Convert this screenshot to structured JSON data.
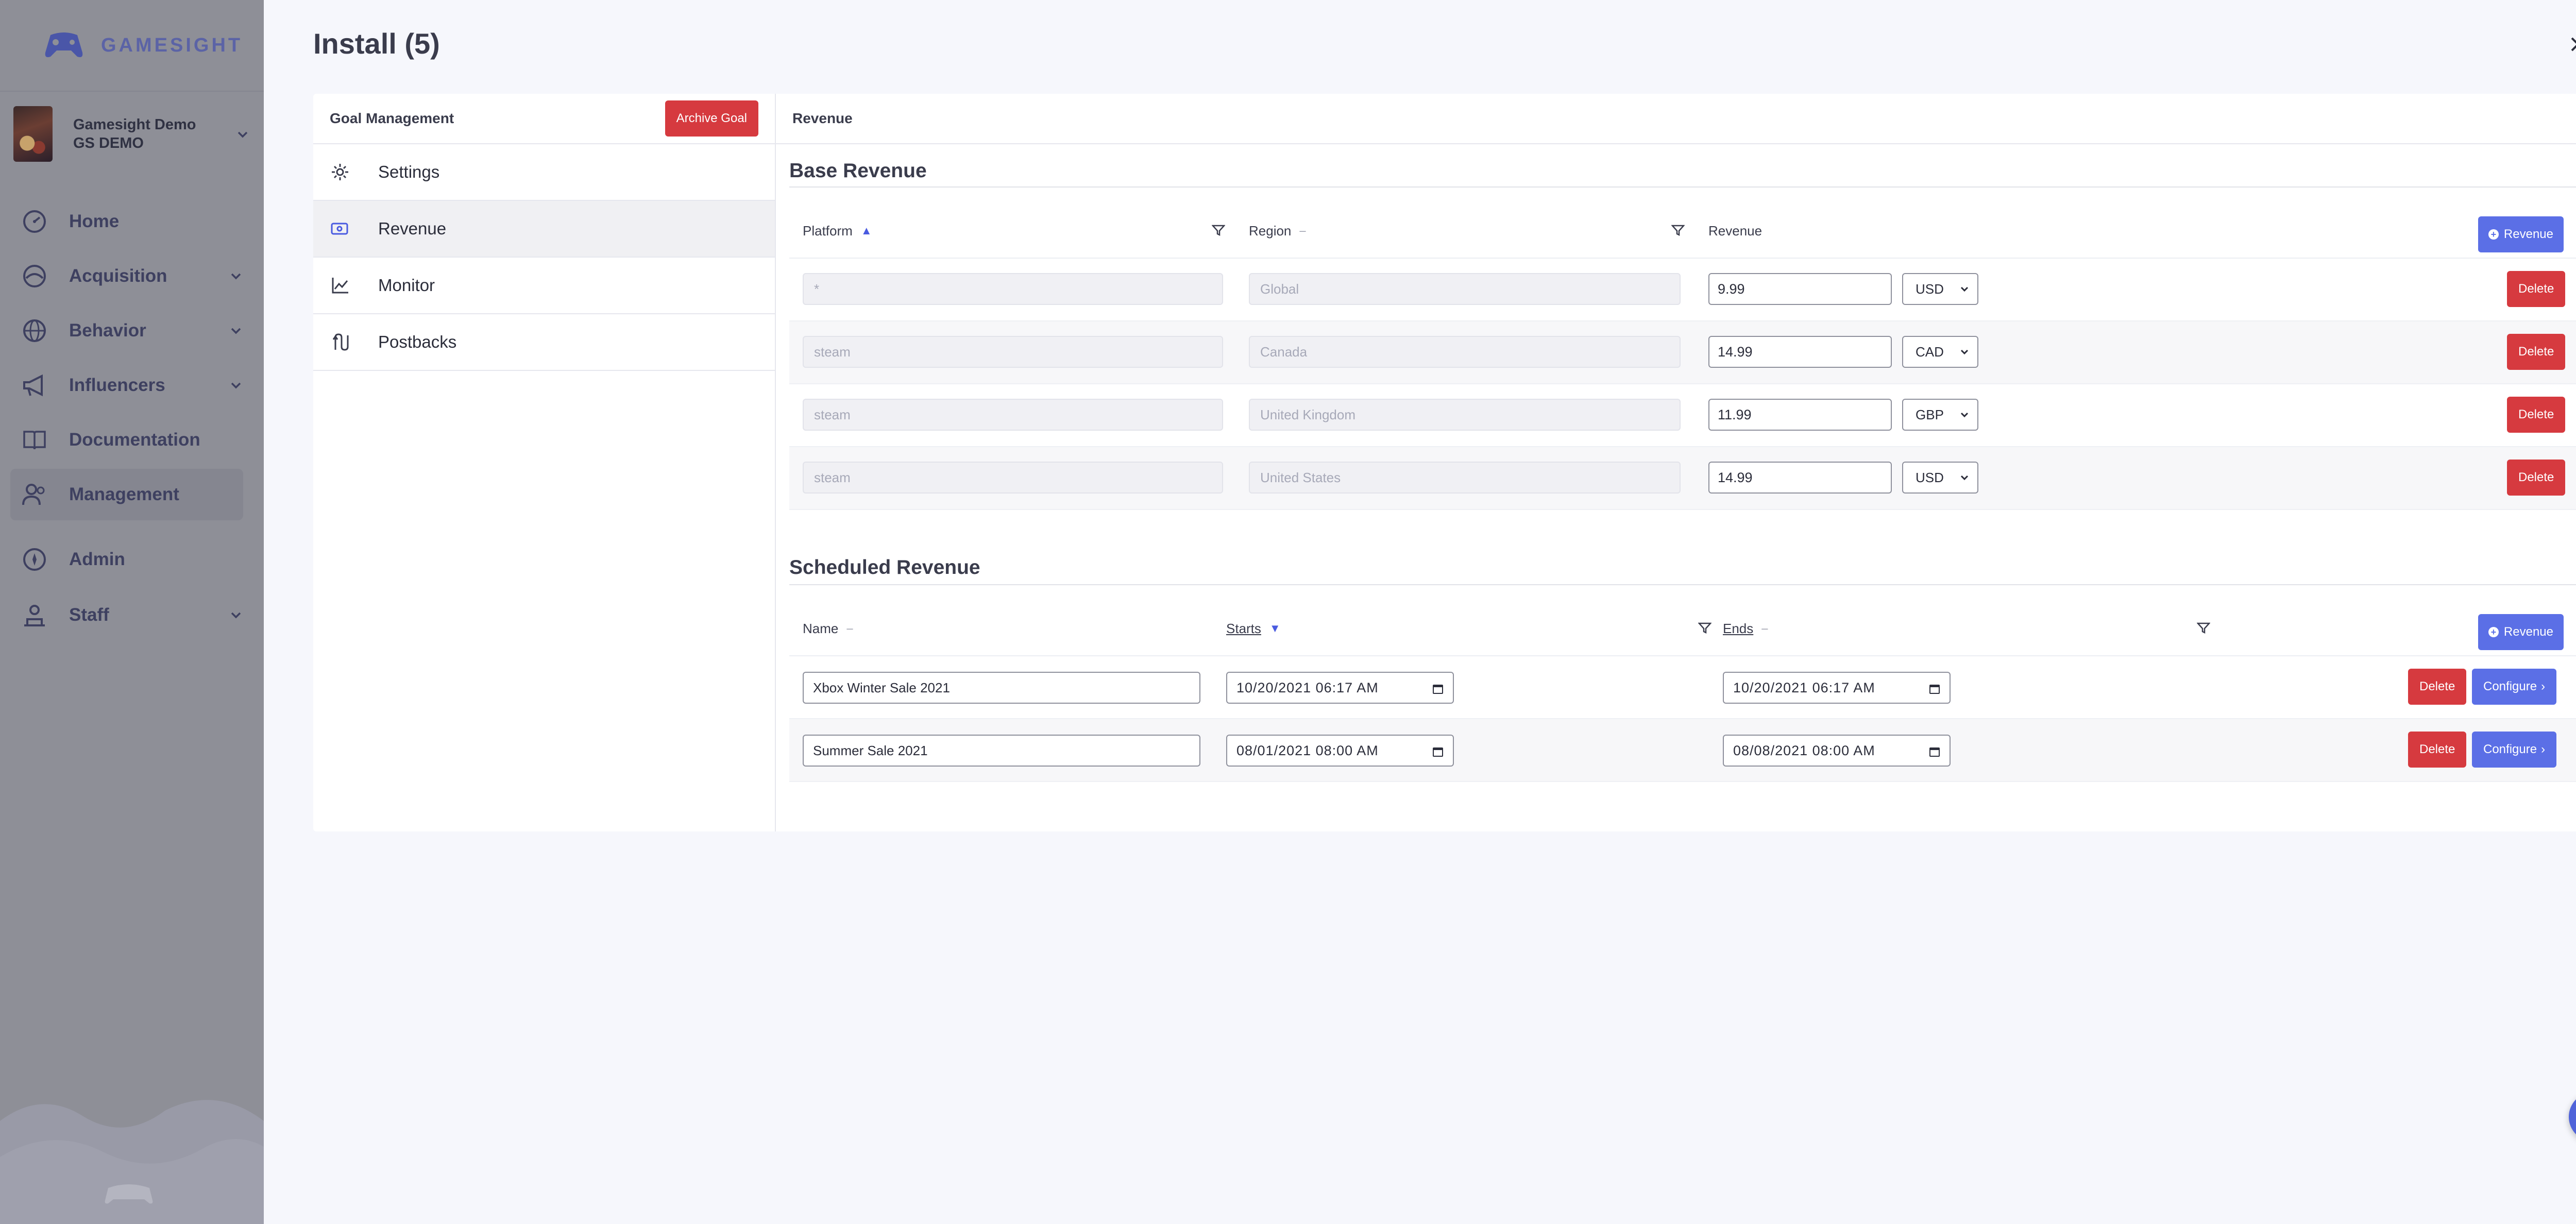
{
  "brand": {
    "name": "GAMESIGHT",
    "logo_icon": "gamepad-icon"
  },
  "account": {
    "line1": "Gamesight Demo",
    "line2": "GS DEMO"
  },
  "nav": {
    "items": [
      {
        "label": "Home",
        "icon": "dashboard-icon",
        "has_chevron": false
      },
      {
        "label": "Acquisition",
        "icon": "acquisition-icon",
        "has_chevron": true
      },
      {
        "label": "Behavior",
        "icon": "globe-icon",
        "has_chevron": true
      },
      {
        "label": "Influencers",
        "icon": "megaphone-icon",
        "has_chevron": true
      },
      {
        "label": "Documentation",
        "icon": "book-icon",
        "has_chevron": false
      },
      {
        "label": "Management",
        "icon": "users-icon",
        "has_chevron": false,
        "active": true
      },
      {
        "label": "Admin",
        "icon": "compass-icon",
        "has_chevron": false
      },
      {
        "label": "Staff",
        "icon": "badge-icon",
        "has_chevron": true
      }
    ]
  },
  "panel": {
    "title": "Install (5)"
  },
  "goal_management": {
    "title": "Goal Management",
    "archive_label": "Archive Goal",
    "items": [
      {
        "label": "Settings",
        "icon": "gear-icon"
      },
      {
        "label": "Revenue",
        "icon": "cash-icon",
        "active": true
      },
      {
        "label": "Monitor",
        "icon": "line-chart-icon"
      },
      {
        "label": "Postbacks",
        "icon": "postback-icon"
      }
    ]
  },
  "revenue_header": "Revenue",
  "base_revenue": {
    "title": "Base Revenue",
    "columns": {
      "platform": "Platform",
      "region": "Region",
      "revenue": "Revenue"
    },
    "add_label": "Revenue",
    "delete_label": "Delete",
    "rows": [
      {
        "platform": "*",
        "region": "Global",
        "amount": "9.99",
        "currency": "USD"
      },
      {
        "platform": "steam",
        "region": "Canada",
        "amount": "14.99",
        "currency": "CAD"
      },
      {
        "platform": "steam",
        "region": "United Kingdom",
        "amount": "11.99",
        "currency": "GBP"
      },
      {
        "platform": "steam",
        "region": "United States",
        "amount": "14.99",
        "currency": "USD"
      }
    ]
  },
  "scheduled_revenue": {
    "title": "Scheduled Revenue",
    "columns": {
      "name": "Name",
      "starts": "Starts",
      "ends": "Ends"
    },
    "add_label": "Revenue",
    "delete_label": "Delete",
    "configure_label": "Configure",
    "rows": [
      {
        "name": "Xbox Winter Sale 2021",
        "starts": "10/20/2021 06:17 AM",
        "ends": "10/20/2021 06:17 AM"
      },
      {
        "name": "Summer Sale 2021",
        "starts": "08/01/2021 08:00 AM",
        "ends": "08/08/2021 08:00 AM"
      }
    ]
  },
  "colors": {
    "primary": "#5b6fe6",
    "danger": "#d63a3f",
    "sidebar_overlay": "#8e8f97"
  }
}
